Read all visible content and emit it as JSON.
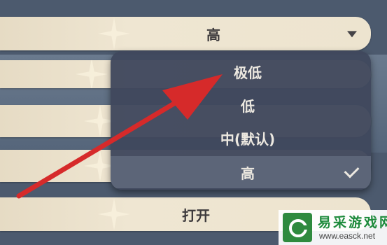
{
  "quality_dropdown": {
    "selected": "高"
  },
  "dropdown_menu": {
    "options": [
      {
        "label": "极低",
        "selected": false
      },
      {
        "label": "低",
        "selected": false
      },
      {
        "label": "中(默认)",
        "selected": false
      },
      {
        "label": "高",
        "selected": true
      }
    ]
  },
  "next_setting": {
    "value": "打开"
  },
  "annotation": {
    "arrow_color": "#d62a2a"
  },
  "watermark": {
    "site_name": "易采游戏网",
    "url": "www.easck.net"
  },
  "colors": {
    "row_bg": "#ece3ce",
    "menu_bg": "#3f485d",
    "selected_bg": "#5c6578",
    "text_dark": "#3d3a3c",
    "text_light": "#ece8e0"
  }
}
